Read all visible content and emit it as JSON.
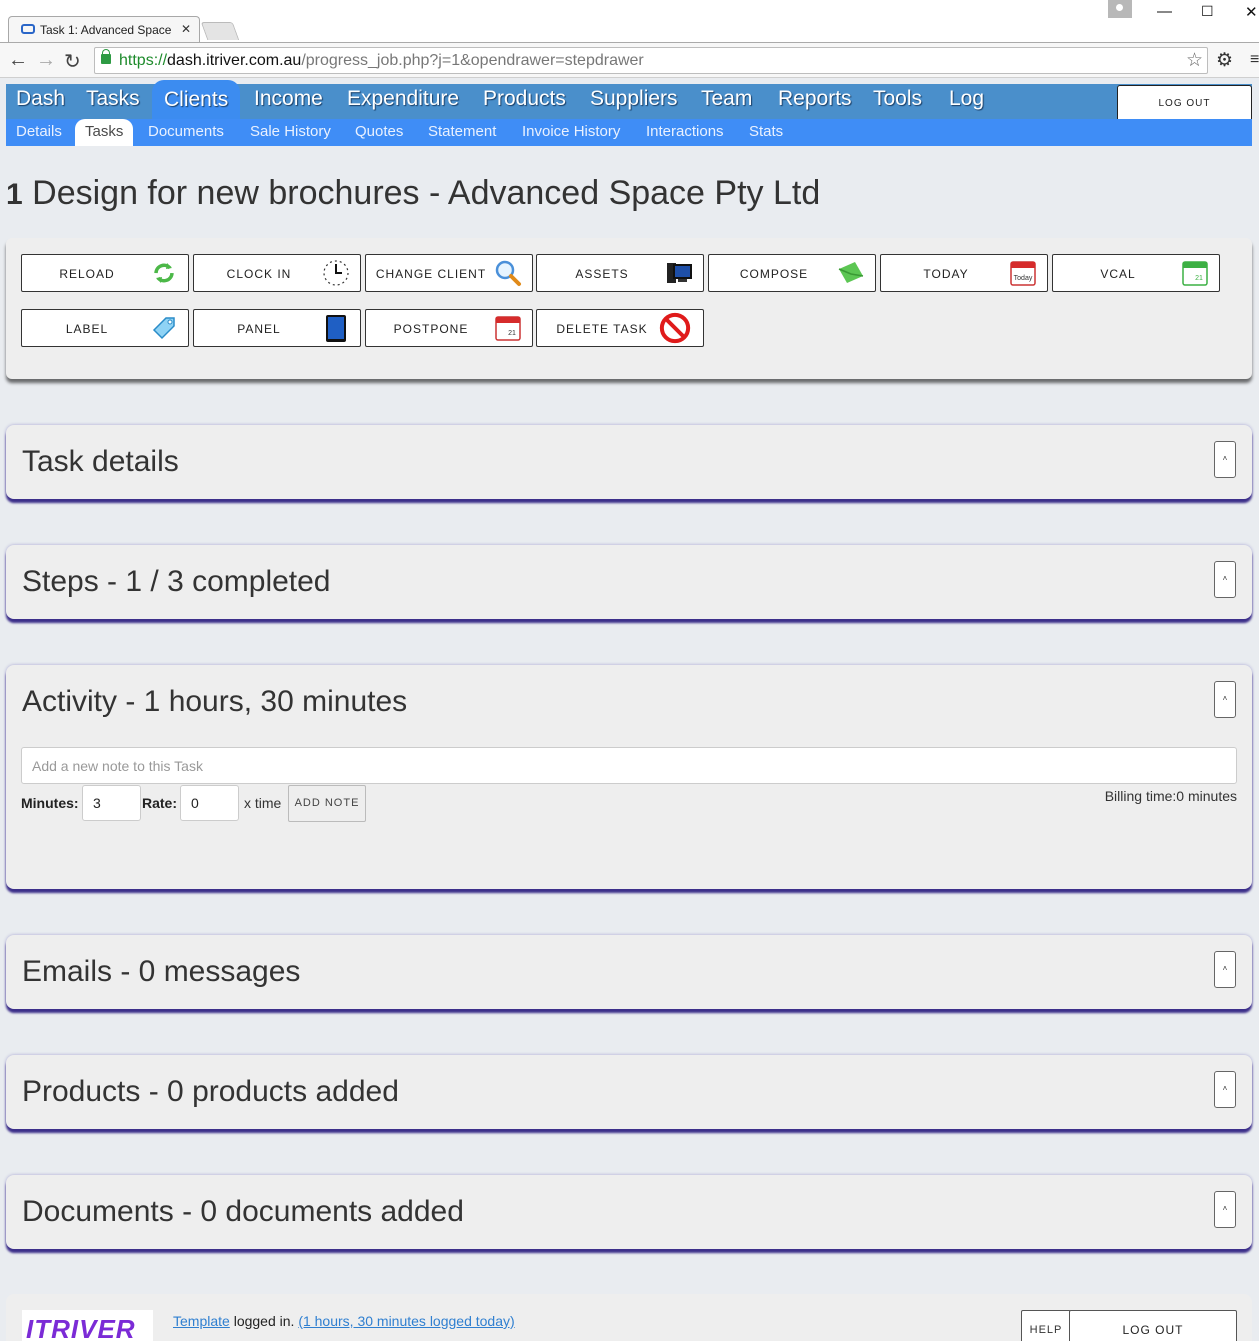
{
  "browser": {
    "tab_title": "Task 1: Advanced Space",
    "url_scheme": "https://",
    "url_host": "dash.itriver.com.au",
    "url_path": "/progress_job.php?j=1&opendrawer=stepdrawer"
  },
  "mainnav": {
    "items": [
      "Dash",
      "Tasks",
      "Clients",
      "Income",
      "Expenditure",
      "Products",
      "Suppliers",
      "Team",
      "Reports",
      "Tools",
      "Log"
    ],
    "active": "Clients",
    "logout_label": "LOG OUT"
  },
  "subnav": {
    "items": [
      "Details",
      "Tasks",
      "Documents",
      "Sale History",
      "Quotes",
      "Statement",
      "Invoice History",
      "Interactions",
      "Stats"
    ],
    "active": "Tasks"
  },
  "page": {
    "task_number": "1",
    "title": "Design for new brochures - Advanced Space Pty Ltd"
  },
  "actions": {
    "reload": "RELOAD",
    "clock_in": "CLOCK IN",
    "change_client": "CHANGE CLIENT",
    "assets": "ASSETS",
    "compose": "COMPOSE",
    "today": "TODAY",
    "vcal": "VCAL",
    "label": "LABEL",
    "panel": "PANEL",
    "postpone": "POSTPONE",
    "delete_task": "DELETE TASK"
  },
  "drawers": {
    "task_details": "Task details",
    "steps": "Steps - 1 / 3 completed",
    "activity": "Activity - 1 hours, 30 minutes",
    "emails": "Emails - 0 messages",
    "products": "Products - 0 products added",
    "documents": "Documents - 0 documents added",
    "toggle_glyph": "˄"
  },
  "activity": {
    "note_placeholder": "Add a new note to this Task",
    "minutes_label": "Minutes:",
    "minutes_value": "3",
    "rate_label": "Rate:",
    "rate_value": "0",
    "x_time": "x time",
    "add_note": "ADD NOTE",
    "billing": "Billing time:0 minutes"
  },
  "footer": {
    "logo_text": "ITRIVER",
    "user_link": "Template",
    "logged_in": " logged in. ",
    "time_link": "(1 hours, 30 minutes logged today)",
    "help": "HELP",
    "logout": "LOG OUT"
  }
}
